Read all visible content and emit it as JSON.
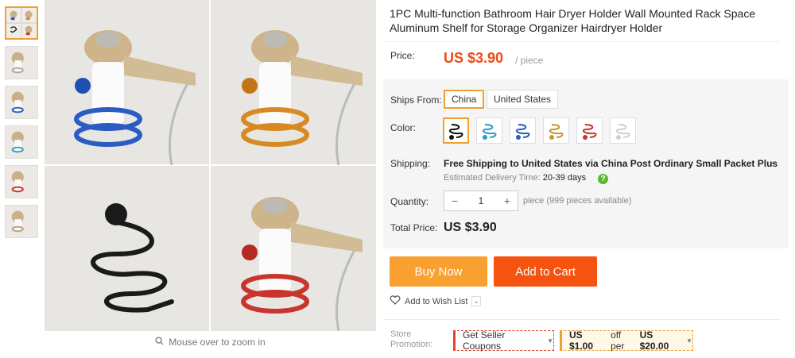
{
  "product": {
    "title": "1PC Multi-function Bathroom Hair Dryer Holder Wall Mounted Rack Space Aluminum Shelf for Storage Organizer Hairdryer Holder",
    "price_label": "Price:",
    "price": "US $3.90",
    "price_unit": "/ piece"
  },
  "gallery": {
    "zoom_hint": "Mouse over to zoom in",
    "thumbnails": [
      "thumb-grid",
      "thumb-blue",
      "thumb-blue",
      "thumb-teal",
      "thumb-red",
      "thumb-gold"
    ]
  },
  "ships_from": {
    "label": "Ships From:",
    "options": [
      "China",
      "United States"
    ],
    "selected": "China"
  },
  "color": {
    "label": "Color:",
    "options": [
      "black",
      "sky-blue",
      "blue",
      "gold",
      "red",
      "silver"
    ],
    "selected": "black"
  },
  "shipping": {
    "label": "Shipping:",
    "text": "Free Shipping to United States via China Post Ordinary Small Packet Plus",
    "delivery_label": "Estimated Delivery Time:",
    "delivery_value": "20-39 days"
  },
  "quantity": {
    "label": "Quantity:",
    "value": "1",
    "minus": "−",
    "plus": "+",
    "note": "piece (999 pieces available)"
  },
  "total": {
    "label": "Total Price:",
    "value": "US $3.90"
  },
  "actions": {
    "buy_now": "Buy Now",
    "add_to_cart": "Add to Cart",
    "wish_list": "Add to Wish List"
  },
  "promotion": {
    "label": "Store Promotion:",
    "coupon": "Get Seller Coupons",
    "discount_amount": "US $1.00",
    "discount_mid": "off per",
    "discount_min": "US $20.00"
  },
  "colors": {
    "accent_orange": "#f04a14",
    "buy_now": "#f8a030",
    "add_to_cart": "#f5530f",
    "selected_border": "#f0a030"
  }
}
